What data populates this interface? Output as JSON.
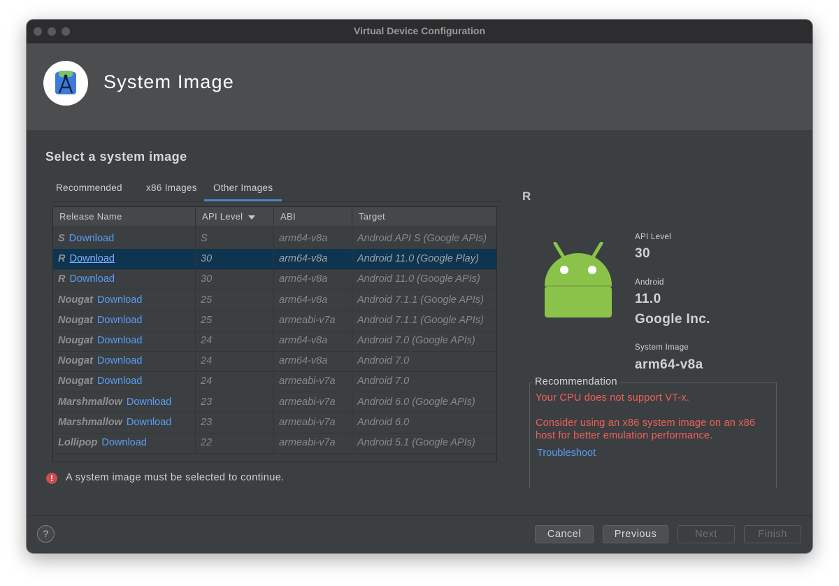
{
  "window": {
    "title": "Virtual Device Configuration"
  },
  "header": {
    "title": "System Image",
    "logo_icon": "android-studio-logo-icon"
  },
  "section_title": "Select a system image",
  "tabs": [
    {
      "label": "Recommended",
      "active": false
    },
    {
      "label": "x86 Images",
      "active": false
    },
    {
      "label": "Other Images",
      "active": true
    }
  ],
  "table": {
    "columns": [
      "Release Name",
      "API Level",
      "ABI",
      "Target"
    ],
    "sort_column": "API Level",
    "rows": [
      {
        "release": "S",
        "action": "Download",
        "api": "S",
        "abi": "arm64-v8a",
        "target": "Android API S (Google APIs)",
        "selected": false
      },
      {
        "release": "R",
        "action": "Download",
        "api": "30",
        "abi": "arm64-v8a",
        "target": "Android 11.0 (Google Play)",
        "selected": true
      },
      {
        "release": "R",
        "action": "Download",
        "api": "30",
        "abi": "arm64-v8a",
        "target": "Android 11.0 (Google APIs)",
        "selected": false
      },
      {
        "release": "Nougat",
        "action": "Download",
        "api": "25",
        "abi": "arm64-v8a",
        "target": "Android 7.1.1 (Google APIs)",
        "selected": false
      },
      {
        "release": "Nougat",
        "action": "Download",
        "api": "25",
        "abi": "armeabi-v7a",
        "target": "Android 7.1.1 (Google APIs)",
        "selected": false
      },
      {
        "release": "Nougat",
        "action": "Download",
        "api": "24",
        "abi": "arm64-v8a",
        "target": "Android 7.0 (Google APIs)",
        "selected": false
      },
      {
        "release": "Nougat",
        "action": "Download",
        "api": "24",
        "abi": "arm64-v8a",
        "target": "Android 7.0",
        "selected": false
      },
      {
        "release": "Nougat",
        "action": "Download",
        "api": "24",
        "abi": "armeabi-v7a",
        "target": "Android 7.0",
        "selected": false
      },
      {
        "release": "Marshmallow",
        "action": "Download",
        "api": "23",
        "abi": "armeabi-v7a",
        "target": "Android 6.0 (Google APIs)",
        "selected": false
      },
      {
        "release": "Marshmallow",
        "action": "Download",
        "api": "23",
        "abi": "armeabi-v7a",
        "target": "Android 6.0",
        "selected": false
      },
      {
        "release": "Lollipop",
        "action": "Download",
        "api": "22",
        "abi": "armeabi-v7a",
        "target": "Android 5.1 (Google APIs)",
        "selected": false
      }
    ]
  },
  "details": {
    "release_letter": "R",
    "api_level_label": "API Level",
    "api_level_value": "30",
    "android_label": "Android",
    "android_value": "11.0",
    "vendor": "Google Inc.",
    "system_image_label": "System Image",
    "system_image_value": "arm64-v8a",
    "android_icon": "android-robot-icon"
  },
  "recommendation": {
    "title": "Recommendation",
    "line1": "Your CPU does not support VT-x.",
    "line2": "Consider using an x86 system image on an x86 host for better emulation performance.",
    "link": "Troubleshoot"
  },
  "error_message": "A system image must be selected to continue.",
  "buttons": {
    "help": "?",
    "cancel": "Cancel",
    "previous": "Previous",
    "next": "Next",
    "finish": "Finish"
  },
  "colors": {
    "background": "#3c3f41",
    "header": "#4b4d4f",
    "selection": "#0e3450",
    "link": "#589df6",
    "error": "#f0605a",
    "android_green": "#8bc34a"
  }
}
